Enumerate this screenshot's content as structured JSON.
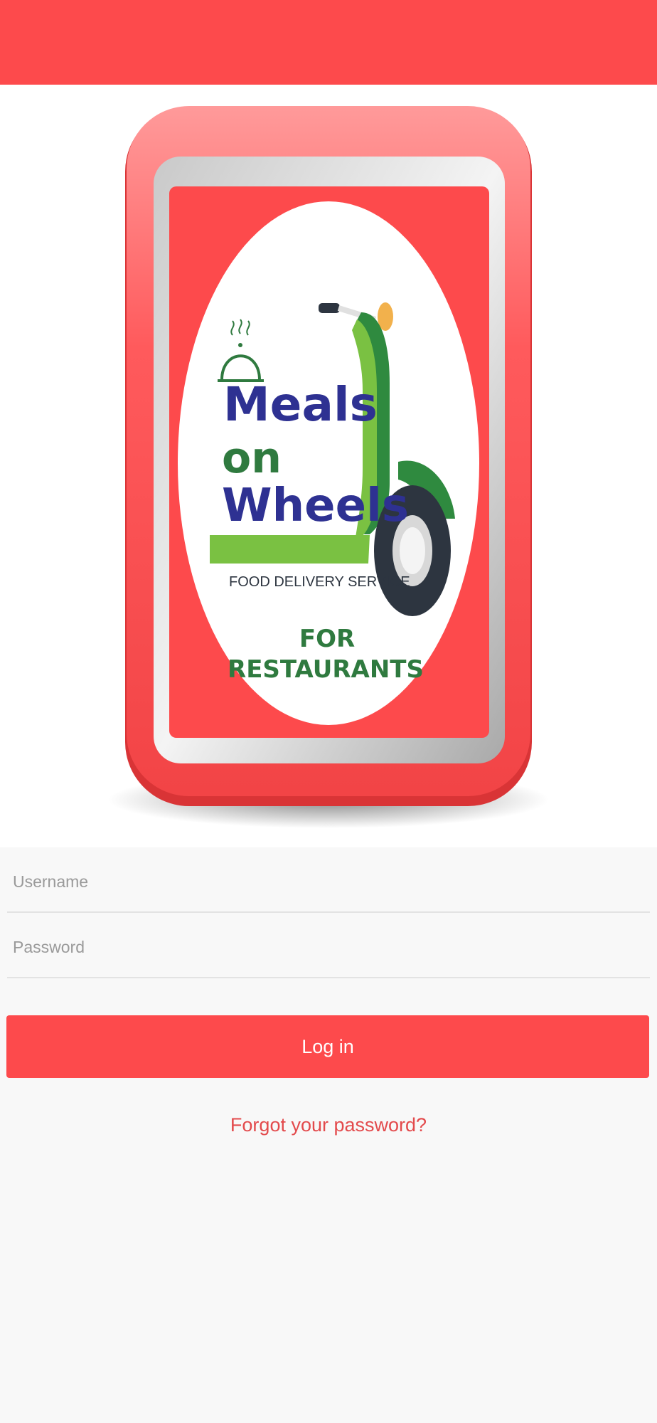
{
  "header": {
    "bar_color": "#fd4a4c"
  },
  "logo": {
    "line1": "Meals",
    "line2": "on",
    "line3": "Wheels",
    "tagline": "FOOD DELIVERY SERVICE",
    "sub1": "FOR",
    "sub2": "RESTAURANTS",
    "icons": [
      "food-cloche-icon",
      "scooter-icon"
    ]
  },
  "form": {
    "username_placeholder": "Username",
    "username_value": "",
    "password_placeholder": "Password",
    "password_value": "",
    "login_label": "Log in",
    "forgot_label": "Forgot your password?"
  },
  "colors": {
    "accent": "#fd4a4c",
    "logo_text_blue": "#2e3192",
    "logo_green": "#7ac142",
    "dark_green": "#2f7a3f",
    "background": "#f8f8f8"
  }
}
